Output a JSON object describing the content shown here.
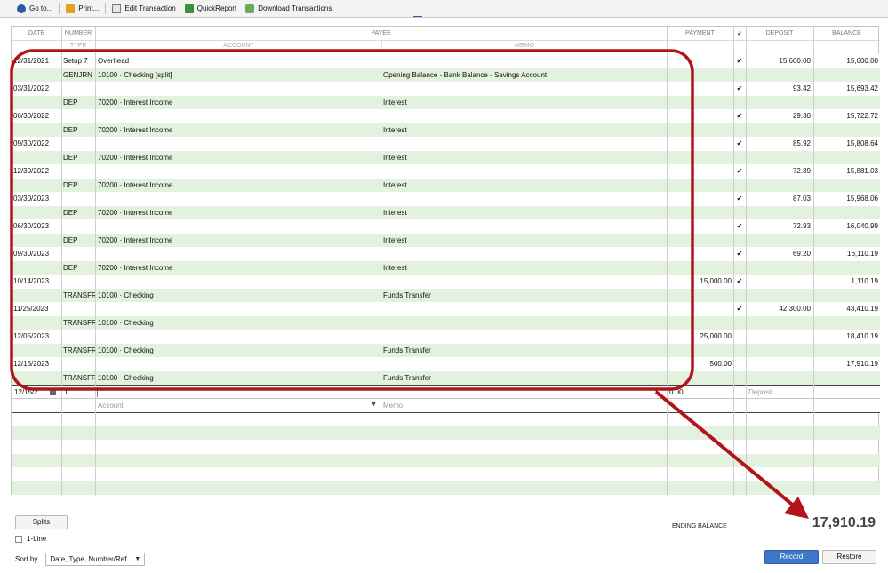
{
  "toolbar": {
    "goto": "Go to...",
    "print": "Print...",
    "edit": "Edit Transaction",
    "quickreport": "QuickReport",
    "download": "Download Transactions"
  },
  "headers": {
    "date": "DATE",
    "number": "NUMBER",
    "type": "TYPE",
    "payee": "PAYEE",
    "account": "ACCOUNT",
    "memo": "MEMO",
    "payment": "PAYMENT",
    "check": "✔",
    "deposit": "DEPOSIT",
    "balance": "BALANCE"
  },
  "transactions": [
    {
      "date": "12/31/2021",
      "number": "Setup 7",
      "payee": "Overhead",
      "payment": "",
      "cleared": "✔",
      "deposit": "15,600.00",
      "balance": "15,600.00",
      "type": "GENJRN",
      "account": "10100 · Checking [split]",
      "memo": "Opening Balance - Bank Balance - Savings Account"
    },
    {
      "date": "03/31/2022",
      "number": "",
      "payee": "",
      "payment": "",
      "cleared": "✔",
      "deposit": "93.42",
      "balance": "15,693.42",
      "type": "DEP",
      "account": "70200 · Interest Income",
      "memo": "Interest"
    },
    {
      "date": "06/30/2022",
      "number": "",
      "payee": "",
      "payment": "",
      "cleared": "✔",
      "deposit": "29.30",
      "balance": "15,722.72",
      "type": "DEP",
      "account": "70200 · Interest Income",
      "memo": "Interest"
    },
    {
      "date": "09/30/2022",
      "number": "",
      "payee": "",
      "payment": "",
      "cleared": "✔",
      "deposit": "85.92",
      "balance": "15,808.64",
      "type": "DEP",
      "account": "70200 · Interest Income",
      "memo": "Interest"
    },
    {
      "date": "12/30/2022",
      "number": "",
      "payee": "",
      "payment": "",
      "cleared": "✔",
      "deposit": "72.39",
      "balance": "15,881.03",
      "type": "DEP",
      "account": "70200 · Interest Income",
      "memo": "Interest"
    },
    {
      "date": "03/30/2023",
      "number": "",
      "payee": "",
      "payment": "",
      "cleared": "✔",
      "deposit": "87.03",
      "balance": "15,968.06",
      "type": "DEP",
      "account": "70200 · Interest Income",
      "memo": "Interest"
    },
    {
      "date": "06/30/2023",
      "number": "",
      "payee": "",
      "payment": "",
      "cleared": "✔",
      "deposit": "72.93",
      "balance": "16,040.99",
      "type": "DEP",
      "account": "70200 · Interest Income",
      "memo": "Interest"
    },
    {
      "date": "09/30/2023",
      "number": "",
      "payee": "",
      "payment": "",
      "cleared": "✔",
      "deposit": "69.20",
      "balance": "16,110.19",
      "type": "DEP",
      "account": "70200 · Interest Income",
      "memo": "Interest"
    },
    {
      "date": "10/14/2023",
      "number": "",
      "payee": "",
      "payment": "15,000.00",
      "cleared": "✔",
      "deposit": "",
      "balance": "1,110.19",
      "type": "TRANSFR",
      "account": "10100 · Checking",
      "memo": "Funds Transfer"
    },
    {
      "date": "11/25/2023",
      "number": "",
      "payee": "",
      "payment": "",
      "cleared": "✔",
      "deposit": "42,300.00",
      "balance": "43,410.19",
      "type": "TRANSFR",
      "account": "10100 · Checking",
      "memo": ""
    },
    {
      "date": "12/05/2023",
      "number": "",
      "payee": "",
      "payment": "25,000.00",
      "cleared": "",
      "deposit": "",
      "balance": "18,410.19",
      "type": "TRANSFR",
      "account": "10100 · Checking",
      "memo": "Funds Transfer"
    },
    {
      "date": "12/15/2023",
      "number": "",
      "payee": "",
      "payment": "500.00",
      "cleared": "",
      "deposit": "",
      "balance": "17,910.19",
      "type": "TRANSFR",
      "account": "10100 · Checking",
      "memo": "Funds Transfer"
    }
  ],
  "entry": {
    "date": "12/15/2...",
    "number": "1",
    "payment": "0.00",
    "deposit_placeholder": "Deposit",
    "account_placeholder": "Account",
    "memo_placeholder": "Memo"
  },
  "bottom": {
    "splits": "Splits",
    "oneline": "1-Line",
    "sortby_label": "Sort by",
    "sortby_value": "Date, Type, Number/Ref",
    "ending_balance_label": "ENDING BALANCE",
    "ending_balance_value": "17,910.19",
    "record": "Record",
    "restore": "Restore"
  },
  "colors": {
    "stripe": "#e3f1df",
    "annotation": "#b3141b",
    "record_button": "#3f77c6"
  }
}
